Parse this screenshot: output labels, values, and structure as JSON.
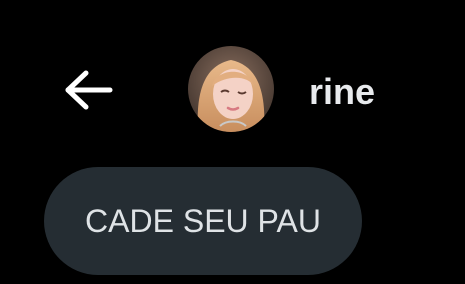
{
  "header": {
    "back_icon": "arrow-left-icon",
    "contact_name": "rine"
  },
  "conversation": {
    "messages": [
      {
        "text": "CADE SEU PAU"
      }
    ]
  },
  "colors": {
    "background": "#000000",
    "bubble": "#252d33",
    "name_text": "#e8eaed",
    "message_text": "#dfe3e6",
    "icon": "#ffffff"
  }
}
